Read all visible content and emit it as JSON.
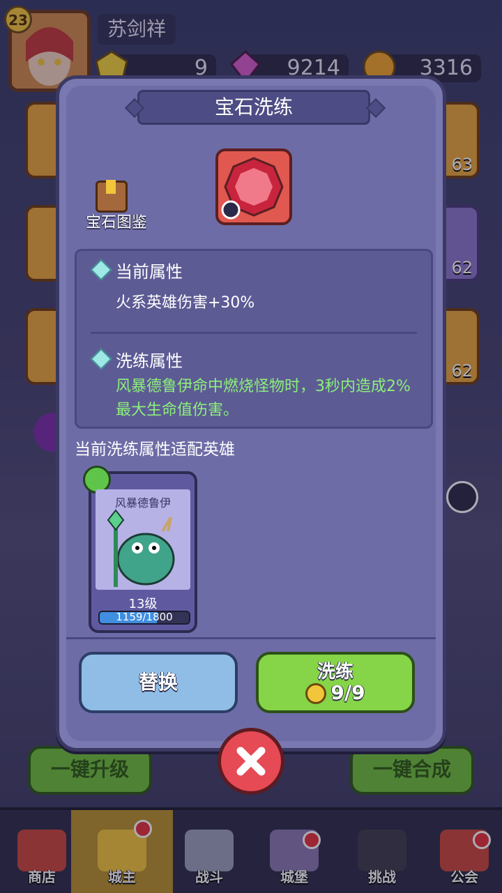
{
  "player": {
    "level": "23",
    "name": "苏剑祥"
  },
  "resources": [
    {
      "icon": "yellow-gem-icon",
      "value": "9"
    },
    {
      "icon": "pink-crystal-icon",
      "value": "9214"
    },
    {
      "icon": "gold-coin-icon",
      "value": "3316"
    }
  ],
  "modal": {
    "title": "宝石洗练",
    "gem_icon": "red-gem-icon",
    "book_label": "宝石图鉴",
    "current_attr": {
      "heading": "当前属性",
      "text": "火系英雄伤害+30%"
    },
    "refine_attr": {
      "heading": "洗练属性",
      "text": "风暴德鲁伊命中燃烧怪物时，3秒内造成2%最大生命值伤害。"
    },
    "fit_label": "当前洗练属性适配英雄",
    "hero": {
      "name": "风暴德鲁伊",
      "level": "13级",
      "exp_text": "1159/1800",
      "exp_fraction": 0.644
    },
    "replace_label": "替换",
    "refine_label": "洗练",
    "refine_cost": "9/9"
  },
  "side_slots": {
    "right_counts": [
      "63",
      "62",
      "62"
    ]
  },
  "bottom_buttons": {
    "upgrade_all": "一键升级",
    "merge_all": "一键合成"
  },
  "nav": [
    {
      "label": "商店",
      "icon": "shop-icon"
    },
    {
      "label": "城主",
      "icon": "crown-icon"
    },
    {
      "label": "战斗",
      "icon": "swords-icon"
    },
    {
      "label": "城堡",
      "icon": "castle-icon"
    },
    {
      "label": "挑战",
      "icon": "demon-icon"
    },
    {
      "label": "公会",
      "icon": "guild-flag-icon"
    }
  ],
  "colors": {
    "modal_bg": "#6e6ca6",
    "green_text": "#8cf07a",
    "refine_button": "#86d448",
    "replace_button": "#8fbde6",
    "close_button": "#e54a55"
  }
}
